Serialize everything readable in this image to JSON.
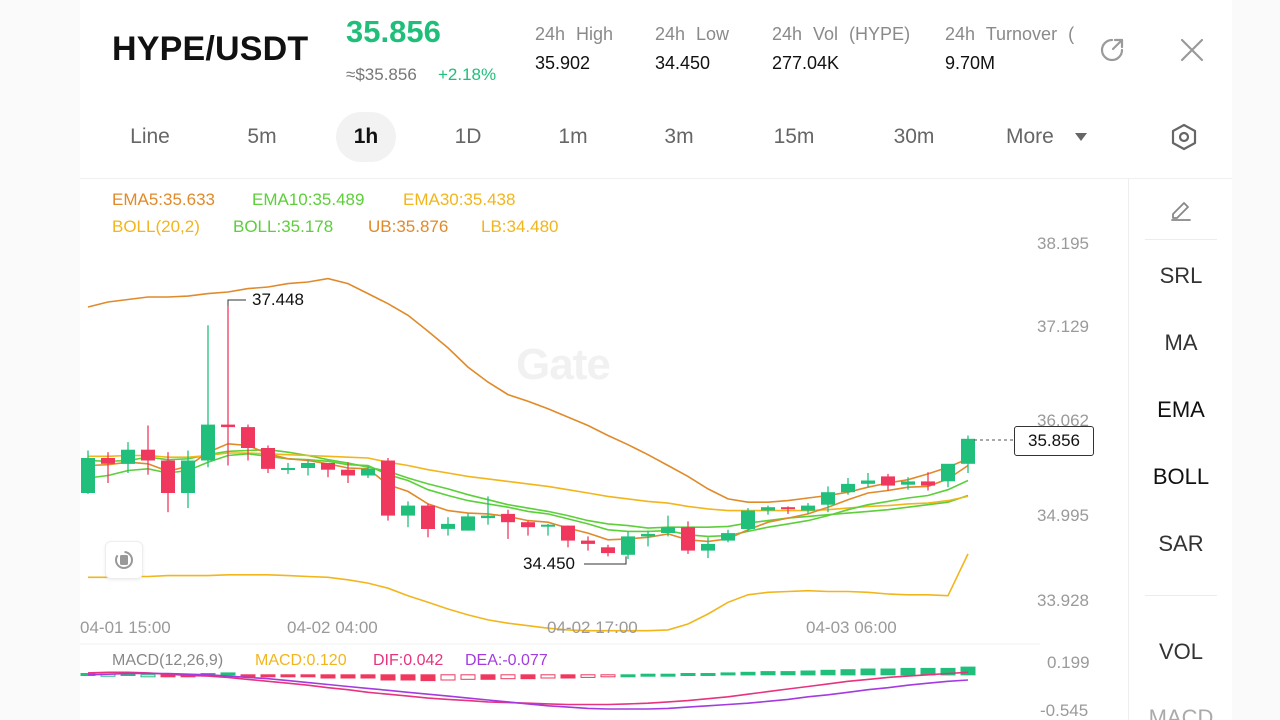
{
  "header": {
    "pair": "HYPE/USDT",
    "last_price": "35.856",
    "approx_price": "≈$35.856",
    "change_pct": "+2.18%",
    "stats": [
      {
        "label": "24h High",
        "value": "35.902"
      },
      {
        "label": "24h Low",
        "value": "34.450"
      },
      {
        "label": "24h Vol (HYPE)",
        "value": "277.04K"
      },
      {
        "label": "24h Turnover (",
        "value": "9.70M"
      }
    ],
    "icons": {
      "refresh": "refresh-icon",
      "close": "close-icon"
    }
  },
  "intervals": {
    "items": [
      "Line",
      "5m",
      "1h",
      "1D",
      "1m",
      "3m",
      "15m",
      "30m",
      "More"
    ],
    "active": "1h",
    "more_icon": "caret-down-icon",
    "settings_icon": "hexagon-settings-icon"
  },
  "indicators": {
    "ema5": "EMA5:35.633",
    "ema10": "EMA10:35.489",
    "ema30": "EMA30:35.438",
    "boll_params": "BOLL(20,2)",
    "boll_mid": "BOLL:35.178",
    "boll_ub": "UB:35.876",
    "boll_lb": "LB:34.480"
  },
  "price_axis": [
    "38.195",
    "37.129",
    "36.062",
    "34.995",
    "33.928"
  ],
  "time_axis": [
    "04-01 15:00",
    "04-02 04:00",
    "04-02 17:00",
    "04-03 06:00"
  ],
  "annotations": {
    "high": "37.448",
    "low": "34.450",
    "current": "35.856"
  },
  "watermark": "Gate",
  "macd": {
    "params": "MACD(12,26,9)",
    "macd": "MACD:0.120",
    "dif": "DIF:0.042",
    "dea": "DEA:-0.077",
    "axis": [
      "0.199",
      "-0.545"
    ]
  },
  "side_panel": {
    "edit_icon": "pencil-icon",
    "items": [
      "SRL",
      "MA",
      "EMA",
      "BOLL",
      "SAR"
    ],
    "bottom_items": [
      "VOL",
      "MACD"
    ]
  },
  "colors": {
    "up": "#20bf7b",
    "down": "#f0385f",
    "ema5": "#e08a2a",
    "ema10": "#5ccf3a",
    "ema30": "#f2b61c",
    "macd_dif": "#e8337f",
    "macd_dea": "#a33be0"
  },
  "chart_data": {
    "type": "candlestick",
    "interval": "1h",
    "ohlc": [
      [
        35.21,
        35.72,
        35.2,
        35.63
      ],
      [
        35.63,
        35.7,
        35.33,
        35.56
      ],
      [
        35.56,
        35.82,
        35.45,
        35.73
      ],
      [
        35.73,
        36.02,
        35.43,
        35.6
      ],
      [
        35.6,
        35.7,
        34.98,
        35.21
      ],
      [
        35.21,
        35.72,
        35.03,
        35.6
      ],
      [
        35.6,
        37.22,
        35.52,
        36.03
      ],
      [
        36.03,
        37.45,
        35.54,
        36.0
      ],
      [
        36.0,
        36.03,
        35.6,
        35.75
      ],
      [
        35.75,
        35.78,
        35.45,
        35.5
      ],
      [
        35.5,
        35.57,
        35.44,
        35.51
      ],
      [
        35.51,
        35.61,
        35.42,
        35.57
      ],
      [
        35.57,
        35.57,
        35.4,
        35.49
      ],
      [
        35.49,
        35.58,
        35.33,
        35.42
      ],
      [
        35.42,
        35.53,
        35.39,
        35.5
      ],
      [
        35.6,
        35.63,
        34.88,
        34.94
      ],
      [
        34.94,
        35.11,
        34.8,
        35.06
      ],
      [
        35.06,
        35.08,
        34.68,
        34.78
      ],
      [
        34.78,
        34.92,
        34.7,
        34.84
      ],
      [
        34.76,
        34.97,
        34.76,
        34.93
      ],
      [
        34.91,
        35.17,
        34.83,
        34.94
      ],
      [
        34.96,
        35.01,
        34.66,
        34.86
      ],
      [
        34.86,
        34.88,
        34.7,
        34.8
      ],
      [
        34.82,
        34.84,
        34.7,
        34.83
      ],
      [
        34.82,
        34.82,
        34.56,
        34.64
      ],
      [
        34.64,
        34.69,
        34.52,
        34.6
      ],
      [
        34.56,
        34.59,
        34.45,
        34.49
      ],
      [
        34.47,
        34.75,
        34.42,
        34.69
      ],
      [
        34.69,
        34.76,
        34.57,
        34.72
      ],
      [
        34.73,
        34.94,
        34.69,
        34.8
      ],
      [
        34.8,
        34.87,
        34.48,
        34.52
      ],
      [
        34.52,
        34.68,
        34.43,
        34.6
      ],
      [
        34.64,
        34.77,
        34.62,
        34.73
      ],
      [
        34.78,
        35.03,
        34.75,
        35.0
      ],
      [
        35.0,
        35.06,
        34.95,
        35.04
      ],
      [
        35.04,
        35.05,
        34.96,
        35.02
      ],
      [
        35.0,
        35.09,
        34.96,
        35.06
      ],
      [
        35.07,
        35.29,
        34.98,
        35.22
      ],
      [
        35.22,
        35.39,
        35.19,
        35.32
      ],
      [
        35.32,
        35.45,
        35.28,
        35.36
      ],
      [
        35.41,
        35.44,
        35.24,
        35.3
      ],
      [
        35.31,
        35.4,
        35.25,
        35.35
      ],
      [
        35.35,
        35.46,
        35.24,
        35.3
      ],
      [
        35.35,
        35.5,
        35.28,
        35.56
      ],
      [
        35.56,
        35.9,
        35.45,
        35.86
      ]
    ],
    "ema5": [
      35.54,
      35.55,
      35.58,
      35.56,
      35.47,
      35.53,
      35.7,
      35.8,
      35.78,
      35.68,
      35.62,
      35.6,
      35.56,
      35.51,
      35.5,
      35.31,
      35.23,
      35.08,
      35.0,
      34.97,
      34.96,
      34.93,
      34.88,
      34.86,
      34.79,
      34.73,
      34.65,
      34.66,
      34.68,
      34.72,
      34.65,
      34.63,
      34.66,
      34.77,
      34.86,
      34.91,
      34.96,
      35.04,
      35.13,
      35.21,
      35.24,
      35.28,
      35.29,
      35.38,
      35.54
    ],
    "ema10": [
      35.39,
      35.42,
      35.48,
      35.5,
      35.45,
      35.48,
      35.58,
      35.66,
      35.68,
      35.65,
      35.62,
      35.61,
      35.59,
      35.55,
      35.54,
      35.43,
      35.36,
      35.25,
      35.18,
      35.12,
      35.08,
      35.04,
      34.99,
      34.96,
      34.9,
      34.84,
      34.77,
      34.75,
      34.75,
      34.76,
      34.71,
      34.69,
      34.7,
      34.75,
      34.8,
      34.84,
      34.88,
      34.94,
      35.01,
      35.07,
      35.11,
      35.15,
      35.18,
      35.25,
      35.36
    ],
    "ema30": [
      35.65,
      35.65,
      35.66,
      35.66,
      35.64,
      35.64,
      35.66,
      35.69,
      35.69,
      35.68,
      35.67,
      35.66,
      35.65,
      35.64,
      35.63,
      35.58,
      35.54,
      35.49,
      35.45,
      35.41,
      35.38,
      35.35,
      35.32,
      35.29,
      35.25,
      35.21,
      35.17,
      35.14,
      35.11,
      35.09,
      35.05,
      35.02,
      35.0,
      35.0,
      35.0,
      35.0,
      35.0,
      35.01,
      35.03,
      35.05,
      35.06,
      35.08,
      35.09,
      35.12,
      35.17
    ],
    "boll_ub": [
      37.44,
      37.5,
      37.53,
      37.56,
      37.56,
      37.57,
      37.6,
      37.62,
      37.66,
      37.68,
      37.72,
      37.74,
      37.78,
      37.72,
      37.6,
      37.48,
      37.34,
      37.15,
      36.95,
      36.72,
      36.54,
      36.39,
      36.31,
      36.22,
      36.12,
      36.02,
      35.9,
      35.79,
      35.67,
      35.54,
      35.41,
      35.26,
      35.14,
      35.1,
      35.1,
      35.12,
      35.15,
      35.18,
      35.22,
      35.28,
      35.33,
      35.37,
      35.44,
      35.52,
      35.62
    ],
    "boll_mid": [
      35.6,
      35.59,
      35.6,
      35.64,
      35.61,
      35.62,
      35.67,
      35.71,
      35.72,
      35.73,
      35.7,
      35.66,
      35.61,
      35.57,
      35.52,
      35.47,
      35.39,
      35.32,
      35.26,
      35.19,
      35.13,
      35.07,
      35.03,
      34.99,
      34.94,
      34.88,
      34.84,
      34.82,
      34.79,
      34.8,
      34.8,
      34.8,
      34.81,
      34.85,
      34.88,
      34.91,
      34.93,
      34.95,
      34.97,
      34.99,
      35.01,
      35.04,
      35.07,
      35.1,
      35.18
    ],
    "boll_lb": [
      34.2,
      34.2,
      34.21,
      34.21,
      34.22,
      34.22,
      34.22,
      34.23,
      34.23,
      34.23,
      34.22,
      34.21,
      34.2,
      34.17,
      34.13,
      34.07,
      33.98,
      33.9,
      33.82,
      33.75,
      33.69,
      33.65,
      33.62,
      33.59,
      33.57,
      33.56,
      33.56,
      33.56,
      33.56,
      33.57,
      33.64,
      33.76,
      33.9,
      33.99,
      34.02,
      34.03,
      34.04,
      34.03,
      34.03,
      34.02,
      34.0,
      33.99,
      33.99,
      33.98,
      34.48
    ],
    "macd_hist": [
      0.02,
      0.01,
      0.02,
      0.0,
      -0.02,
      -0.02,
      0.02,
      0.03,
      -0.01,
      -0.02,
      -0.03,
      -0.03,
      -0.05,
      -0.05,
      -0.05,
      -0.08,
      -0.08,
      -0.09,
      -0.08,
      -0.07,
      -0.07,
      -0.06,
      -0.06,
      -0.05,
      -0.05,
      -0.04,
      -0.03,
      0.0,
      0.01,
      0.01,
      0.02,
      0.02,
      0.03,
      0.04,
      0.05,
      0.05,
      0.06,
      0.07,
      0.08,
      0.09,
      0.09,
      0.1,
      0.1,
      0.1,
      0.12
    ],
    "macd_dif": [
      0.03,
      0.04,
      0.04,
      0.03,
      0.01,
      -0.01,
      -0.02,
      -0.04,
      -0.07,
      -0.1,
      -0.13,
      -0.16,
      -0.2,
      -0.23,
      -0.27,
      -0.3,
      -0.33,
      -0.36,
      -0.38,
      -0.4,
      -0.42,
      -0.43,
      -0.44,
      -0.45,
      -0.46,
      -0.46,
      -0.46,
      -0.45,
      -0.44,
      -0.42,
      -0.4,
      -0.37,
      -0.34,
      -0.3,
      -0.26,
      -0.22,
      -0.18,
      -0.14,
      -0.1,
      -0.07,
      -0.04,
      -0.02,
      0.0,
      0.02,
      0.04
    ],
    "macd_dea": [
      0.0,
      0.01,
      0.02,
      0.02,
      0.02,
      0.01,
      0.0,
      -0.02,
      -0.04,
      -0.06,
      -0.09,
      -0.12,
      -0.15,
      -0.18,
      -0.21,
      -0.24,
      -0.27,
      -0.3,
      -0.33,
      -0.36,
      -0.39,
      -0.42,
      -0.45,
      -0.48,
      -0.5,
      -0.52,
      -0.53,
      -0.53,
      -0.53,
      -0.52,
      -0.5,
      -0.48,
      -0.46,
      -0.44,
      -0.41,
      -0.38,
      -0.34,
      -0.31,
      -0.27,
      -0.23,
      -0.2,
      -0.16,
      -0.13,
      -0.1,
      -0.08
    ],
    "ylim": [
      33.928,
      38.195
    ],
    "macd_ylim": [
      -0.545,
      0.199
    ]
  }
}
